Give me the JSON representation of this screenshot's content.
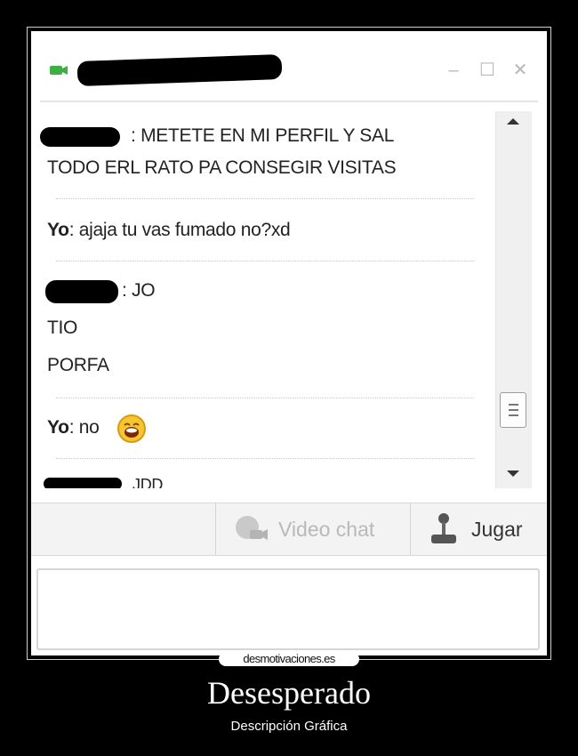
{
  "window": {
    "title_redacted": true,
    "controls": {
      "minimize": "–",
      "maximize": "☐",
      "close": "✕"
    },
    "accent_color": "#3cb043"
  },
  "chat": {
    "messages": [
      {
        "sender": "[redacted]",
        "text": ": METETE EN MI PERFIL Y SAL"
      },
      {
        "sender": "",
        "text": "TODO ERL RATO PA CONSEGIR VISITAS"
      },
      {
        "sender": "Yo",
        "text": ": ajaja tu vas fumado no?xd"
      },
      {
        "sender": "[redacted]",
        "text": ": JO"
      },
      {
        "sender": "",
        "text": "TIO"
      },
      {
        "sender": "",
        "text": "PORFA"
      },
      {
        "sender": "Yo",
        "text": ": no",
        "emoticon": "laughing-emoticon"
      },
      {
        "sender": "[redacted]",
        "text": "JDD"
      }
    ]
  },
  "toolbar": {
    "video_chat_label": "Video chat",
    "play_label": "Jugar"
  },
  "watermark": "desmotivaciones.es",
  "caption": {
    "title": "Desesperado",
    "subtitle": "Descripción Gráfica"
  }
}
